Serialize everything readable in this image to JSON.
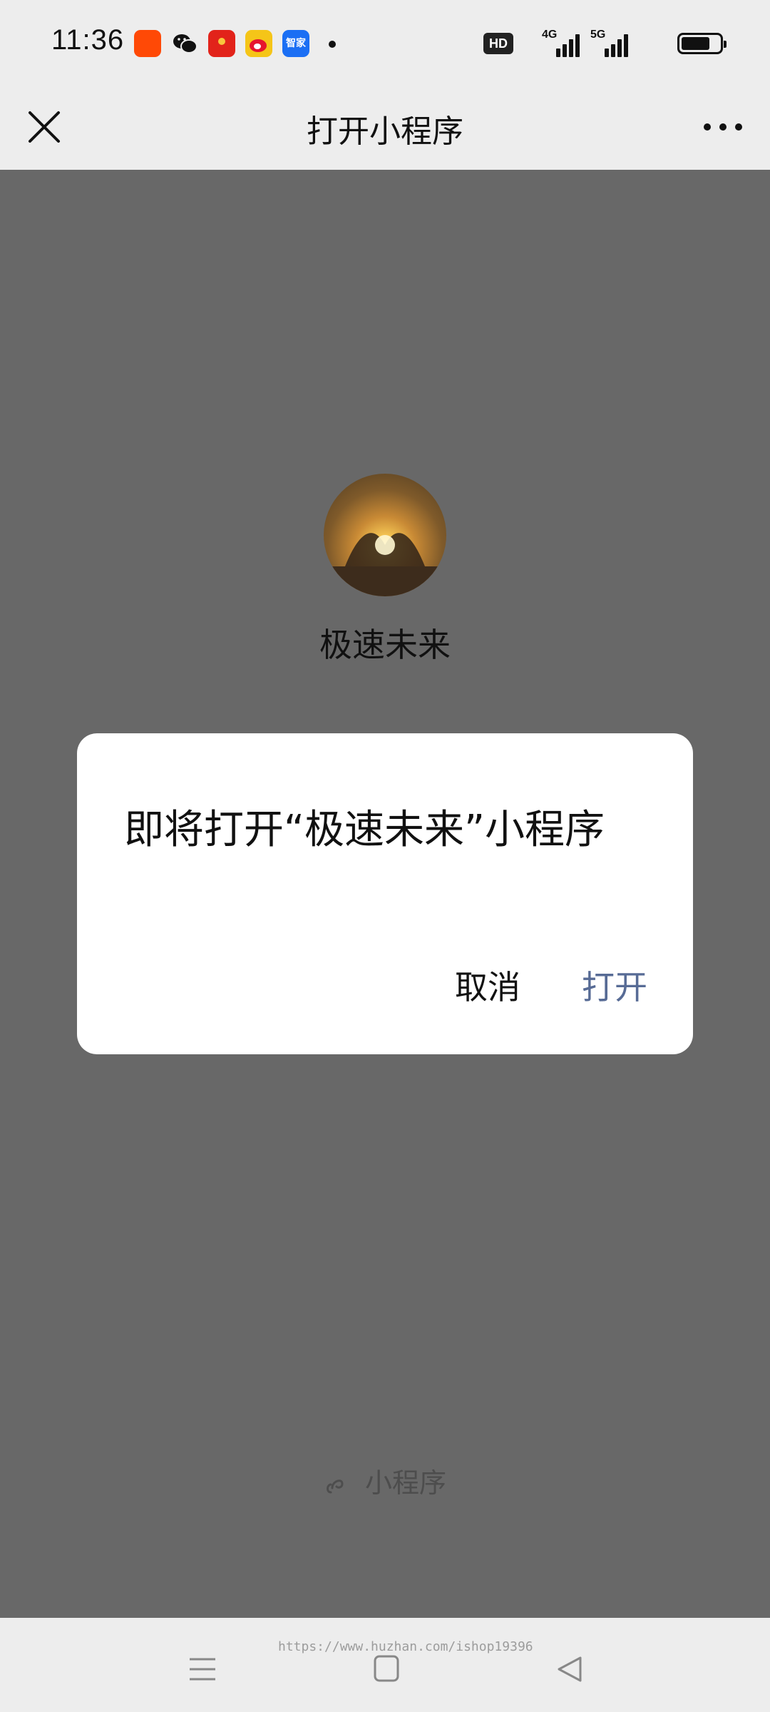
{
  "status_bar": {
    "time": "11:36",
    "hd_label": "HD",
    "sig1_label": "4G",
    "sig2_label": "5G",
    "notification_icons": [
      "kuaishou-icon",
      "wechat-icon",
      "red-packet-icon",
      "weibo-icon",
      "zhijia-icon"
    ],
    "zhijia_label": "智家",
    "battery_level": 0.75
  },
  "nav": {
    "title": "打开小程序",
    "close_icon": "close-icon",
    "more_icon": "more-icon"
  },
  "miniprogram": {
    "name": "极速未来",
    "footer_label": "小程序"
  },
  "dialog": {
    "message": "即将打开“极速未来”小程序",
    "cancel_label": "取消",
    "open_label": "打开",
    "open_color": "#576b95"
  },
  "system_nav": {
    "watermark": "https://www.huzhan.com/ishop19396"
  },
  "colors": {
    "overlay": "#686868",
    "bar_bg": "#ededed"
  }
}
